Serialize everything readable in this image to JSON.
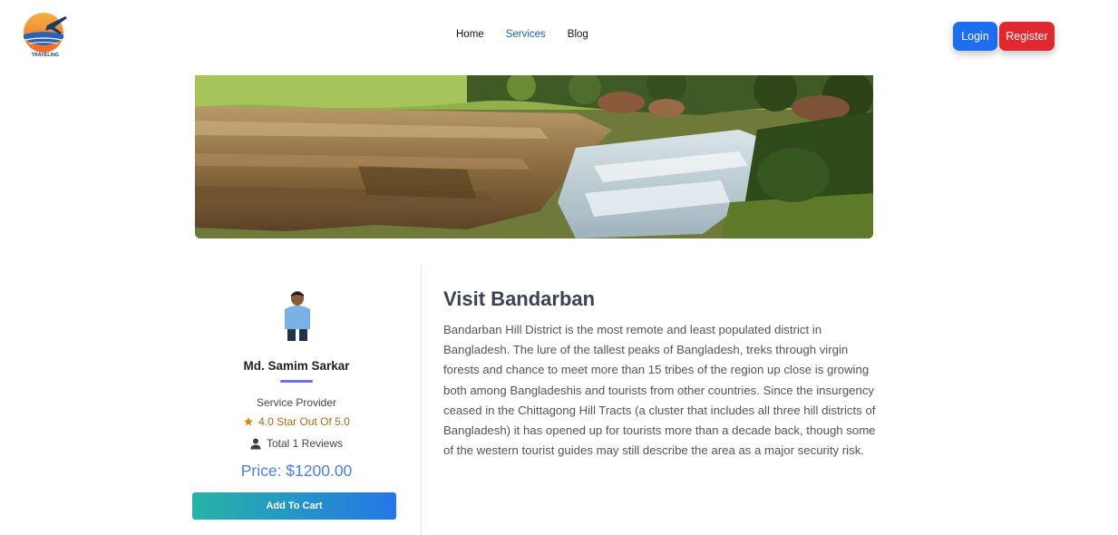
{
  "app": {
    "logo_text": "TRAVELING",
    "logo_name": "traveling-logo"
  },
  "nav": {
    "links": [
      {
        "label": "Home",
        "active": false
      },
      {
        "label": "Services",
        "active": true
      },
      {
        "label": "Blog",
        "active": false
      }
    ],
    "login_label": "Login",
    "register_label": "Register"
  },
  "hero": {
    "image_name": "bandarban-waterfall-image"
  },
  "provider": {
    "name": "Md. Samim Sarkar",
    "role": "Service Provider",
    "rating_text": "4.0 Star Out Of 5.0",
    "reviews_text": "Total 1 Reviews",
    "price_text": "Price: $1200.00",
    "add_to_cart_label": "Add To Cart"
  },
  "service": {
    "title": "Visit Bandarban",
    "description": "Bandarban Hill District is the most remote and least populated district in Bangladesh. The lure of the tallest peaks of Bangladesh, treks through virgin forests and chance to meet more than 15 tribes of the region up close is growing both among Bangladeshis and tourists from other countries. Since the insurgency ceased in the Chittagong Hill Tracts (a cluster that includes all three hill districts of Bangladesh) it has opened up for tourists more than a decade back, though some of the western tourist guides may still describe the area as a major security risk."
  },
  "colors": {
    "login_bg": "#1e6ef0",
    "register_bg": "#e0282e",
    "active_nav": "#1d5fa8",
    "price": "#4f7fd8",
    "rating": "#a66d10",
    "cart_gradient_start": "#27b4a6",
    "cart_gradient_end": "#2576e8"
  },
  "icons": {
    "rating": "star-icon",
    "reviews": "user-icon"
  }
}
